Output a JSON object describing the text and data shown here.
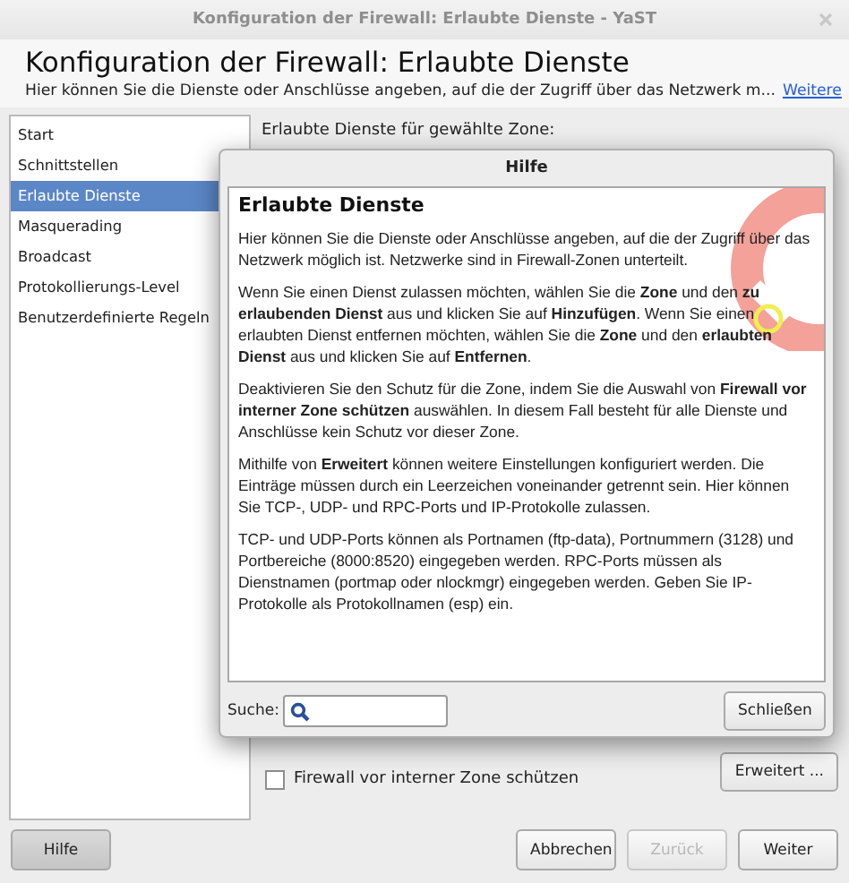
{
  "window": {
    "title": "Konfiguration der Firewall: Erlaubte Dienste - YaST"
  },
  "header": {
    "title": "Konfiguration der Firewall: Erlaubte Dienste",
    "description": "Hier können Sie die Dienste oder Anschlüsse angeben, auf die der Zugriff über das Netzwerk m...",
    "link": "Weitere"
  },
  "sidebar": {
    "items": [
      {
        "label": "Start",
        "selected": false
      },
      {
        "label": "Schnittstellen",
        "selected": false
      },
      {
        "label": "Erlaubte Dienste",
        "selected": true
      },
      {
        "label": "Masquerading",
        "selected": false
      },
      {
        "label": "Broadcast",
        "selected": false
      },
      {
        "label": "Protokollierungs-Level",
        "selected": false
      },
      {
        "label": "Benutzerdefinierte Regeln",
        "selected": false
      }
    ]
  },
  "content": {
    "zone_label": "Erlaubte Dienste für gewählte Zone:",
    "checkbox": {
      "label": "Firewall vor interner Zone schützen",
      "checked": false
    },
    "advanced_button": "Erweitert ..."
  },
  "footer": {
    "buttons": [
      {
        "label": "Hilfe",
        "kind": "help",
        "disabled": false
      },
      {
        "label": "Abbrechen",
        "kind": "normal",
        "disabled": false
      },
      {
        "label": "Zurück",
        "kind": "normal",
        "disabled": true
      },
      {
        "label": "Weiter",
        "kind": "normal",
        "disabled": false
      }
    ]
  },
  "help_dialog": {
    "title": "Hilfe",
    "heading": "Erlaubte Dienste",
    "paragraphs": [
      "Hier können Sie die Dienste oder Anschlüsse angeben, auf die der Zugriff über das Netzwerk möglich ist. Netzwerke sind in Firewall-Zonen unterteilt.",
      "Wenn Sie einen Dienst zulassen möchten, wählen Sie die **Zone** und den **zu erlaubenden Dienst** aus und klicken Sie auf **Hinzufügen**. Wenn Sie einen erlaubten Dienst entfernen möchten, wählen Sie die **Zone** und den **erlaubten Dienst** aus und klicken Sie auf **Entfernen**.",
      "Deaktivieren Sie den Schutz für die Zone, indem Sie die Auswahl von **Firewall vor interner Zone schützen** auswählen. In diesem Fall besteht für alle Dienste und Anschlüsse kein Schutz vor dieser Zone.",
      "Mithilfe von **Erweitert** können weitere Einstellungen konfiguriert werden. Die Einträge müssen durch ein Leerzeichen voneinander getrennt sein. Hier können Sie TCP-, UDP- und RPC-Ports und IP-Protokolle zulassen.",
      "TCP- und UDP-Ports können als Portnamen (ftp-data), Portnummern (3128) und Portbereiche (8000:8520) eingegeben werden. RPC-Ports müssen als Dienstnamen (portmap oder nlockmgr) eingegeben werden. Geben Sie IP-Protokolle als Protokollnamen (esp) ein."
    ],
    "search": {
      "label": "Suche:"
    },
    "close_button": "Schließen"
  }
}
